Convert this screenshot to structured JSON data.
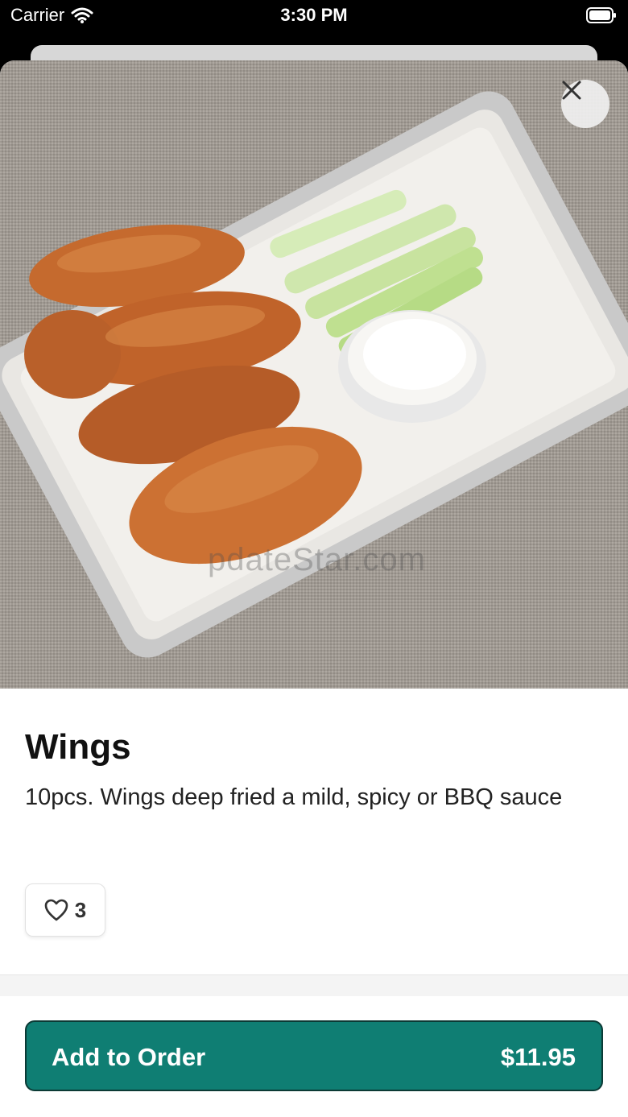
{
  "status_bar": {
    "carrier": "Carrier",
    "time": "3:30 PM",
    "icons": [
      "wifi-icon",
      "battery-icon"
    ]
  },
  "hero": {
    "close_icon": "close-icon",
    "watermark": "pdateStar.com"
  },
  "item": {
    "title": "Wings",
    "description": "10pcs. Wings deep fried a mild, spicy or BBQ sauce",
    "likes": "3",
    "like_icon": "heart-outline-icon"
  },
  "footer": {
    "add_label": "Add to Order",
    "price": "$11.95"
  },
  "colors": {
    "accent": "#0f7e73",
    "accent_border": "#0b3a35",
    "text_primary": "#111111",
    "status_bar_bg": "#000000"
  }
}
